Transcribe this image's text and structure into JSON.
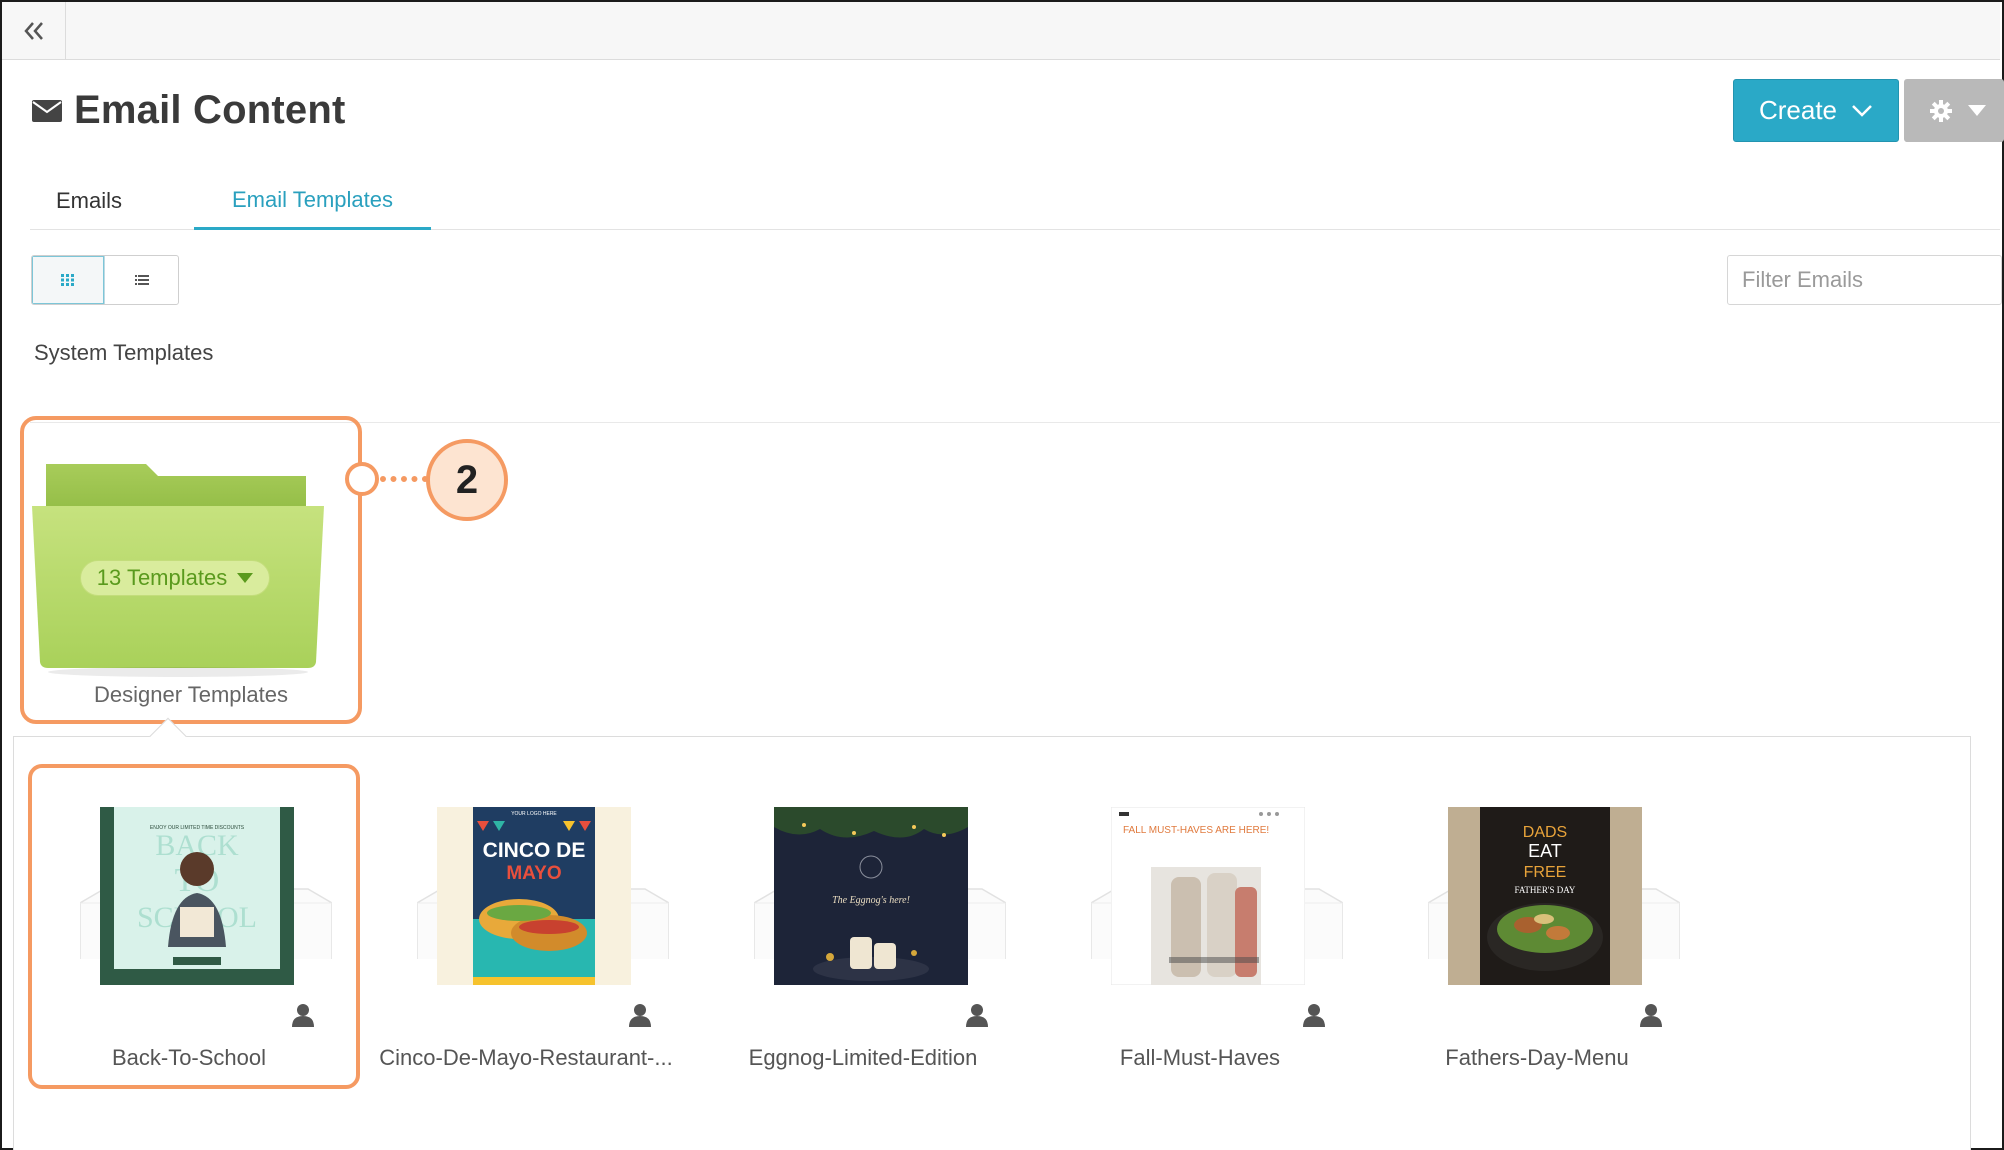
{
  "page": {
    "title": "Email Content",
    "collapse_icon": "double-chevron-left-icon"
  },
  "header": {
    "create_label": "Create",
    "settings_icon": "gear-icon"
  },
  "tabs": [
    {
      "label": "Emails",
      "active": false
    },
    {
      "label": "Email Templates",
      "active": true
    }
  ],
  "view_toggle": {
    "options": [
      "grid-view",
      "list-view"
    ],
    "active": "grid-view"
  },
  "filter": {
    "placeholder": "Filter Emails"
  },
  "section": {
    "label": "System Templates"
  },
  "folder": {
    "badge": "13 Templates",
    "name": "Designer Templates"
  },
  "callout": {
    "number": "2"
  },
  "templates": [
    {
      "name": "Back-To-School",
      "selected": true
    },
    {
      "name": "Cinco-De-Mayo-Restaurant-...",
      "selected": false
    },
    {
      "name": "Eggnog-Limited-Edition",
      "selected": false
    },
    {
      "name": "Fall-Must-Haves",
      "selected": false
    },
    {
      "name": "Fathers-Day-Menu",
      "selected": false
    }
  ],
  "thumb_text": {
    "bts_top": "ENJOY OUR LIMITED TIME DISCOUNTS",
    "bts_big": "BACK TO SCHOOL",
    "cinco_top": "YOUR LOGO HERE",
    "cinco_big1": "CINCO DE",
    "cinco_big2": "MAYO",
    "eggnog": "The Eggnog's here!",
    "fall": "FALL MUST-HAVES ARE HERE!",
    "fathers1": "DADS",
    "fathers2": "EAT",
    "fathers3": "FREE",
    "fathers4": "FATHER'S DAY"
  },
  "colors": {
    "accent": "#2aa9c7",
    "highlight": "#f59a62",
    "folder_green": "#b8d96a"
  }
}
